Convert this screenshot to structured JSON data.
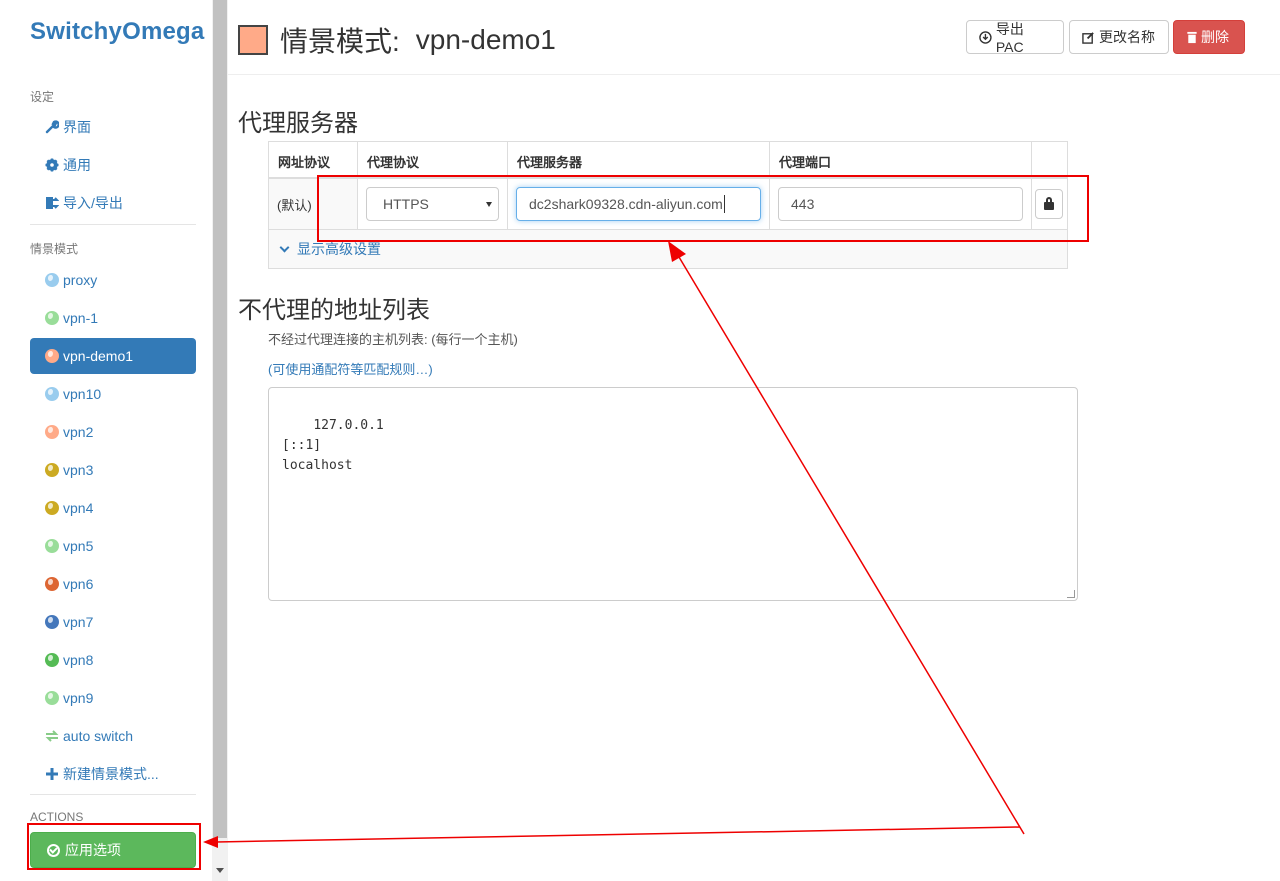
{
  "sidebar": {
    "brand": "SwitchyOmega",
    "settings_header": "设定",
    "settings_items": [
      {
        "label": "界面",
        "icon": "wrench-icon"
      },
      {
        "label": "通用",
        "icon": "gear-icon"
      },
      {
        "label": "导入/导出",
        "icon": "import-export-icon"
      }
    ],
    "profiles_header": "情景模式",
    "profiles": [
      {
        "label": "proxy",
        "color": "#99ccee"
      },
      {
        "label": "vpn-1",
        "color": "#99dd99"
      },
      {
        "label": "vpn-demo1",
        "color": "#ffaa88",
        "active": true
      },
      {
        "label": "vpn10",
        "color": "#99ccee"
      },
      {
        "label": "vpn2",
        "color": "#ffaa88"
      },
      {
        "label": "vpn3",
        "color": "#ccaa22"
      },
      {
        "label": "vpn4",
        "color": "#ccaa22"
      },
      {
        "label": "vpn5",
        "color": "#99dd99"
      },
      {
        "label": "vpn6",
        "color": "#dd6633"
      },
      {
        "label": "vpn7",
        "color": "#4477bb"
      },
      {
        "label": "vpn8",
        "color": "#55bb55"
      },
      {
        "label": "vpn9",
        "color": "#99dd99"
      },
      {
        "label": "auto switch",
        "color": "#99dd99",
        "icon": "switch-icon"
      },
      {
        "label": "新建情景模式...",
        "icon": "plus-icon"
      }
    ],
    "actions_header": "ACTIONS",
    "apply_label": "应用选项"
  },
  "header": {
    "title": "情景模式:",
    "profile_name": "vpn-demo1",
    "swatch_color": "#ffaa88",
    "export_label": "导出PAC",
    "rename_label": "更改名称",
    "delete_label": "删除"
  },
  "proxy_section": {
    "heading": "代理服务器",
    "columns": [
      "网址协议",
      "代理协议",
      "代理服务器",
      "代理端口"
    ],
    "row": {
      "scheme": "(默认)",
      "protocol": "HTTPS",
      "server": "dc2shark09328.cdn-aliyun.com",
      "port": "443"
    },
    "advanced_label": "显示高级设置"
  },
  "bypass_section": {
    "heading": "不代理的地址列表",
    "help": "不经过代理连接的主机列表: (每行一个主机)",
    "wildcard_link": "(可使用通配符等匹配规则…)",
    "list_text": "127.0.0.1\n[::1]\nlocalhost"
  },
  "colors": {
    "accent": "#337ab7",
    "success": "#5cb85c",
    "danger": "#d9534f",
    "annotation": "#ee0000"
  }
}
